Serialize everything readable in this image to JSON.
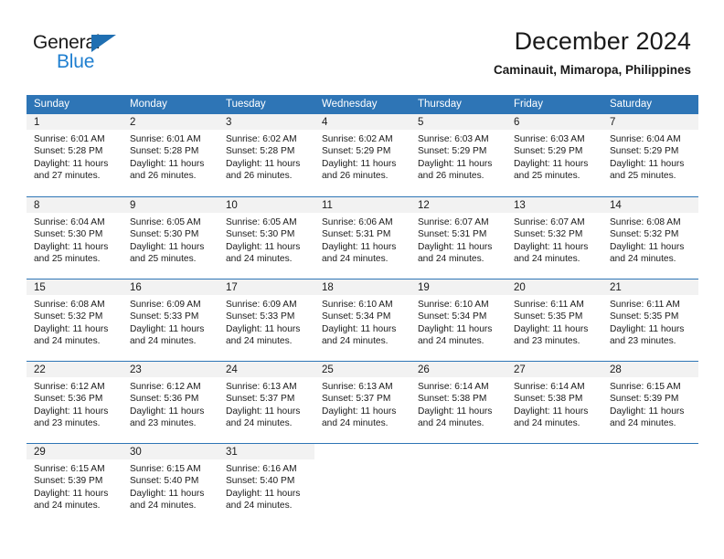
{
  "brand": {
    "name_top": "General",
    "name_bottom": "Blue",
    "triangle_icon": "brand-triangle-icon",
    "accent_color": "#1f7fd0"
  },
  "header": {
    "month_title": "December 2024",
    "location": "Caminauit, Mimaropa, Philippines"
  },
  "calendar": {
    "header_color": "#2e75b6",
    "daynum_band_color": "#f2f2f2",
    "weekday_headers": [
      "Sunday",
      "Monday",
      "Tuesday",
      "Wednesday",
      "Thursday",
      "Friday",
      "Saturday"
    ],
    "labels": {
      "sunrise": "Sunrise:",
      "sunset": "Sunset:",
      "daylight": "Daylight:"
    },
    "weeks": [
      [
        {
          "day": "1",
          "sunrise": "Sunrise: 6:01 AM",
          "sunset": "Sunset: 5:28 PM",
          "daylight_line1": "Daylight: 11 hours",
          "daylight_line2": "and 27 minutes."
        },
        {
          "day": "2",
          "sunrise": "Sunrise: 6:01 AM",
          "sunset": "Sunset: 5:28 PM",
          "daylight_line1": "Daylight: 11 hours",
          "daylight_line2": "and 26 minutes."
        },
        {
          "day": "3",
          "sunrise": "Sunrise: 6:02 AM",
          "sunset": "Sunset: 5:28 PM",
          "daylight_line1": "Daylight: 11 hours",
          "daylight_line2": "and 26 minutes."
        },
        {
          "day": "4",
          "sunrise": "Sunrise: 6:02 AM",
          "sunset": "Sunset: 5:29 PM",
          "daylight_line1": "Daylight: 11 hours",
          "daylight_line2": "and 26 minutes."
        },
        {
          "day": "5",
          "sunrise": "Sunrise: 6:03 AM",
          "sunset": "Sunset: 5:29 PM",
          "daylight_line1": "Daylight: 11 hours",
          "daylight_line2": "and 26 minutes."
        },
        {
          "day": "6",
          "sunrise": "Sunrise: 6:03 AM",
          "sunset": "Sunset: 5:29 PM",
          "daylight_line1": "Daylight: 11 hours",
          "daylight_line2": "and 25 minutes."
        },
        {
          "day": "7",
          "sunrise": "Sunrise: 6:04 AM",
          "sunset": "Sunset: 5:29 PM",
          "daylight_line1": "Daylight: 11 hours",
          "daylight_line2": "and 25 minutes."
        }
      ],
      [
        {
          "day": "8",
          "sunrise": "Sunrise: 6:04 AM",
          "sunset": "Sunset: 5:30 PM",
          "daylight_line1": "Daylight: 11 hours",
          "daylight_line2": "and 25 minutes."
        },
        {
          "day": "9",
          "sunrise": "Sunrise: 6:05 AM",
          "sunset": "Sunset: 5:30 PM",
          "daylight_line1": "Daylight: 11 hours",
          "daylight_line2": "and 25 minutes."
        },
        {
          "day": "10",
          "sunrise": "Sunrise: 6:05 AM",
          "sunset": "Sunset: 5:30 PM",
          "daylight_line1": "Daylight: 11 hours",
          "daylight_line2": "and 24 minutes."
        },
        {
          "day": "11",
          "sunrise": "Sunrise: 6:06 AM",
          "sunset": "Sunset: 5:31 PM",
          "daylight_line1": "Daylight: 11 hours",
          "daylight_line2": "and 24 minutes."
        },
        {
          "day": "12",
          "sunrise": "Sunrise: 6:07 AM",
          "sunset": "Sunset: 5:31 PM",
          "daylight_line1": "Daylight: 11 hours",
          "daylight_line2": "and 24 minutes."
        },
        {
          "day": "13",
          "sunrise": "Sunrise: 6:07 AM",
          "sunset": "Sunset: 5:32 PM",
          "daylight_line1": "Daylight: 11 hours",
          "daylight_line2": "and 24 minutes."
        },
        {
          "day": "14",
          "sunrise": "Sunrise: 6:08 AM",
          "sunset": "Sunset: 5:32 PM",
          "daylight_line1": "Daylight: 11 hours",
          "daylight_line2": "and 24 minutes."
        }
      ],
      [
        {
          "day": "15",
          "sunrise": "Sunrise: 6:08 AM",
          "sunset": "Sunset: 5:32 PM",
          "daylight_line1": "Daylight: 11 hours",
          "daylight_line2": "and 24 minutes."
        },
        {
          "day": "16",
          "sunrise": "Sunrise: 6:09 AM",
          "sunset": "Sunset: 5:33 PM",
          "daylight_line1": "Daylight: 11 hours",
          "daylight_line2": "and 24 minutes."
        },
        {
          "day": "17",
          "sunrise": "Sunrise: 6:09 AM",
          "sunset": "Sunset: 5:33 PM",
          "daylight_line1": "Daylight: 11 hours",
          "daylight_line2": "and 24 minutes."
        },
        {
          "day": "18",
          "sunrise": "Sunrise: 6:10 AM",
          "sunset": "Sunset: 5:34 PM",
          "daylight_line1": "Daylight: 11 hours",
          "daylight_line2": "and 24 minutes."
        },
        {
          "day": "19",
          "sunrise": "Sunrise: 6:10 AM",
          "sunset": "Sunset: 5:34 PM",
          "daylight_line1": "Daylight: 11 hours",
          "daylight_line2": "and 24 minutes."
        },
        {
          "day": "20",
          "sunrise": "Sunrise: 6:11 AM",
          "sunset": "Sunset: 5:35 PM",
          "daylight_line1": "Daylight: 11 hours",
          "daylight_line2": "and 23 minutes."
        },
        {
          "day": "21",
          "sunrise": "Sunrise: 6:11 AM",
          "sunset": "Sunset: 5:35 PM",
          "daylight_line1": "Daylight: 11 hours",
          "daylight_line2": "and 23 minutes."
        }
      ],
      [
        {
          "day": "22",
          "sunrise": "Sunrise: 6:12 AM",
          "sunset": "Sunset: 5:36 PM",
          "daylight_line1": "Daylight: 11 hours",
          "daylight_line2": "and 23 minutes."
        },
        {
          "day": "23",
          "sunrise": "Sunrise: 6:12 AM",
          "sunset": "Sunset: 5:36 PM",
          "daylight_line1": "Daylight: 11 hours",
          "daylight_line2": "and 23 minutes."
        },
        {
          "day": "24",
          "sunrise": "Sunrise: 6:13 AM",
          "sunset": "Sunset: 5:37 PM",
          "daylight_line1": "Daylight: 11 hours",
          "daylight_line2": "and 24 minutes."
        },
        {
          "day": "25",
          "sunrise": "Sunrise: 6:13 AM",
          "sunset": "Sunset: 5:37 PM",
          "daylight_line1": "Daylight: 11 hours",
          "daylight_line2": "and 24 minutes."
        },
        {
          "day": "26",
          "sunrise": "Sunrise: 6:14 AM",
          "sunset": "Sunset: 5:38 PM",
          "daylight_line1": "Daylight: 11 hours",
          "daylight_line2": "and 24 minutes."
        },
        {
          "day": "27",
          "sunrise": "Sunrise: 6:14 AM",
          "sunset": "Sunset: 5:38 PM",
          "daylight_line1": "Daylight: 11 hours",
          "daylight_line2": "and 24 minutes."
        },
        {
          "day": "28",
          "sunrise": "Sunrise: 6:15 AM",
          "sunset": "Sunset: 5:39 PM",
          "daylight_line1": "Daylight: 11 hours",
          "daylight_line2": "and 24 minutes."
        }
      ],
      [
        {
          "day": "29",
          "sunrise": "Sunrise: 6:15 AM",
          "sunset": "Sunset: 5:39 PM",
          "daylight_line1": "Daylight: 11 hours",
          "daylight_line2": "and 24 minutes."
        },
        {
          "day": "30",
          "sunrise": "Sunrise: 6:15 AM",
          "sunset": "Sunset: 5:40 PM",
          "daylight_line1": "Daylight: 11 hours",
          "daylight_line2": "and 24 minutes."
        },
        {
          "day": "31",
          "sunrise": "Sunrise: 6:16 AM",
          "sunset": "Sunset: 5:40 PM",
          "daylight_line1": "Daylight: 11 hours",
          "daylight_line2": "and 24 minutes."
        },
        {
          "day": "",
          "sunrise": "",
          "sunset": "",
          "daylight_line1": "",
          "daylight_line2": ""
        },
        {
          "day": "",
          "sunrise": "",
          "sunset": "",
          "daylight_line1": "",
          "daylight_line2": ""
        },
        {
          "day": "",
          "sunrise": "",
          "sunset": "",
          "daylight_line1": "",
          "daylight_line2": ""
        },
        {
          "day": "",
          "sunrise": "",
          "sunset": "",
          "daylight_line1": "",
          "daylight_line2": ""
        }
      ]
    ]
  }
}
